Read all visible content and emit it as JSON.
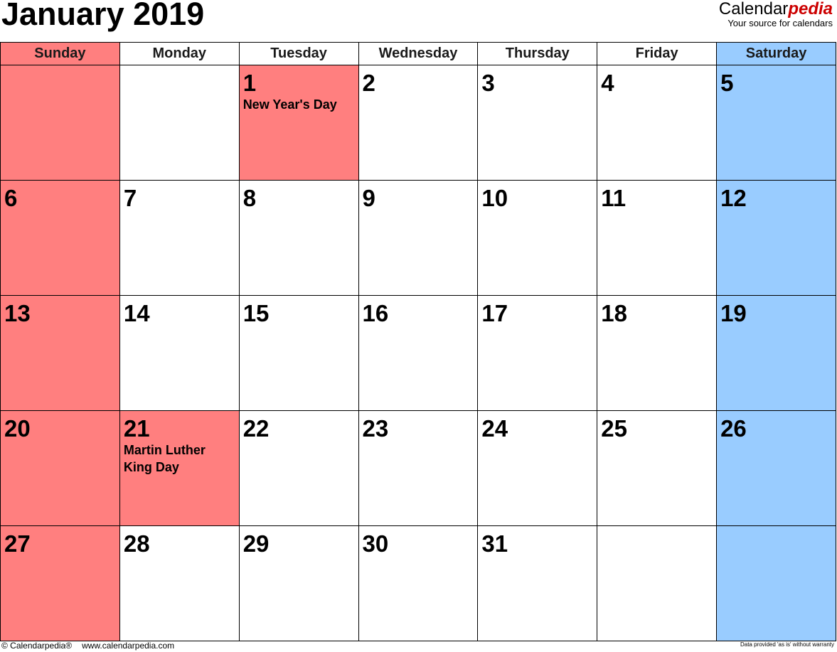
{
  "header": {
    "title": "January 2019",
    "brand_main": "Calendar",
    "brand_accent": "pedia",
    "brand_tagline": "Your source for calendars"
  },
  "colors": {
    "weekend_sunday_holiday": "#ff7f7f",
    "saturday": "#99ccff",
    "brand_accent": "#cc0000"
  },
  "weekdays": [
    "Sunday",
    "Monday",
    "Tuesday",
    "Wednesday",
    "Thursday",
    "Friday",
    "Saturday"
  ],
  "weeks": [
    [
      {
        "day": ""
      },
      {
        "day": ""
      },
      {
        "day": "1",
        "holiday": "New Year's Day"
      },
      {
        "day": "2"
      },
      {
        "day": "3"
      },
      {
        "day": "4"
      },
      {
        "day": "5"
      }
    ],
    [
      {
        "day": "6"
      },
      {
        "day": "7"
      },
      {
        "day": "8"
      },
      {
        "day": "9"
      },
      {
        "day": "10"
      },
      {
        "day": "11"
      },
      {
        "day": "12"
      }
    ],
    [
      {
        "day": "13"
      },
      {
        "day": "14"
      },
      {
        "day": "15"
      },
      {
        "day": "16"
      },
      {
        "day": "17"
      },
      {
        "day": "18"
      },
      {
        "day": "19"
      }
    ],
    [
      {
        "day": "20"
      },
      {
        "day": "21",
        "holiday": "Martin Luther King Day"
      },
      {
        "day": "22"
      },
      {
        "day": "23"
      },
      {
        "day": "24"
      },
      {
        "day": "25"
      },
      {
        "day": "26"
      }
    ],
    [
      {
        "day": "27"
      },
      {
        "day": "28"
      },
      {
        "day": "29"
      },
      {
        "day": "30"
      },
      {
        "day": "31"
      },
      {
        "day": ""
      },
      {
        "day": ""
      }
    ]
  ],
  "footer": {
    "copyright": "© Calendarpedia®",
    "url": "www.calendarpedia.com",
    "disclaimer": "Data provided 'as is' without warranty"
  }
}
